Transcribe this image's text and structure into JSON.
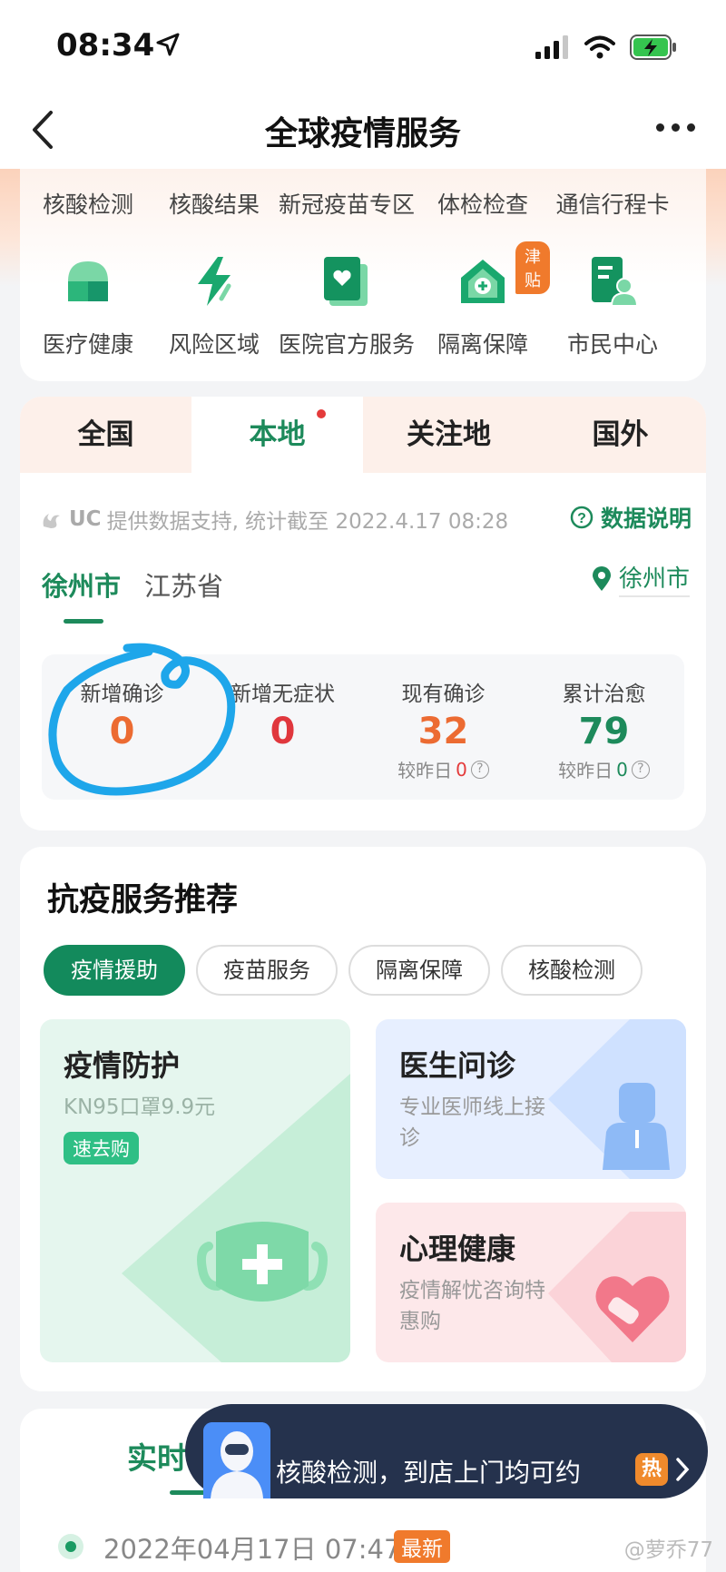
{
  "status": {
    "time": "08:34"
  },
  "nav": {
    "title": "全球疫情服务"
  },
  "quick_links": [
    "核酸检测",
    "核酸结果",
    "新冠疫苗专区",
    "体检检查",
    "通信行程卡"
  ],
  "services": [
    {
      "label": "医疗健康",
      "icon": "medical-health-icon"
    },
    {
      "label": "风险区域",
      "icon": "risk-area-icon"
    },
    {
      "label": "医院官方服务",
      "icon": "hospital-service-icon"
    },
    {
      "label": "隔离保障",
      "icon": "isolation-icon",
      "badge": "津贴"
    },
    {
      "label": "市民中心",
      "icon": "citizen-center-icon"
    }
  ],
  "region_tabs": [
    "全国",
    "本地",
    "关注地",
    "国外"
  ],
  "data_source": {
    "brand": "UC",
    "text": "提供数据支持, 统计截至 2022.4.17 08:28",
    "explain": "数据说明"
  },
  "city_tabs": [
    "徐州市",
    "江苏省"
  ],
  "location": "徐州市",
  "stats": [
    {
      "label": "新增确诊",
      "value": "0",
      "color": "#ec6b32"
    },
    {
      "label": "新增无症状",
      "value": "0",
      "color": "#e0373d"
    },
    {
      "label": "现有确诊",
      "value": "32",
      "color": "#ec6b32",
      "delta_prefix": "较昨日",
      "delta": "0"
    },
    {
      "label": "累计治愈",
      "value": "79",
      "color": "#1d8a5b",
      "delta_prefix": "较昨日",
      "delta": "0"
    }
  ],
  "service_section": {
    "title": "抗疫服务推荐",
    "pills": [
      "疫情援助",
      "疫苗服务",
      "隔离保障",
      "核酸检测"
    ],
    "box1": {
      "title": "疫情防护",
      "sub": "KN95口罩9.9元",
      "tag": "速去购"
    },
    "box2": {
      "title": "医生问诊",
      "sub": "专业医师线上接诊"
    },
    "box3": {
      "title": "心理健康",
      "sub": "疫情解忧咨询特惠购"
    }
  },
  "realtime": {
    "tab": "实时",
    "date": "2022年04月17日 07:47",
    "badge": "最新"
  },
  "banner": {
    "text": "核酸检测，到店上门均可约",
    "hot": "热"
  },
  "watermark": "@萝乔77"
}
